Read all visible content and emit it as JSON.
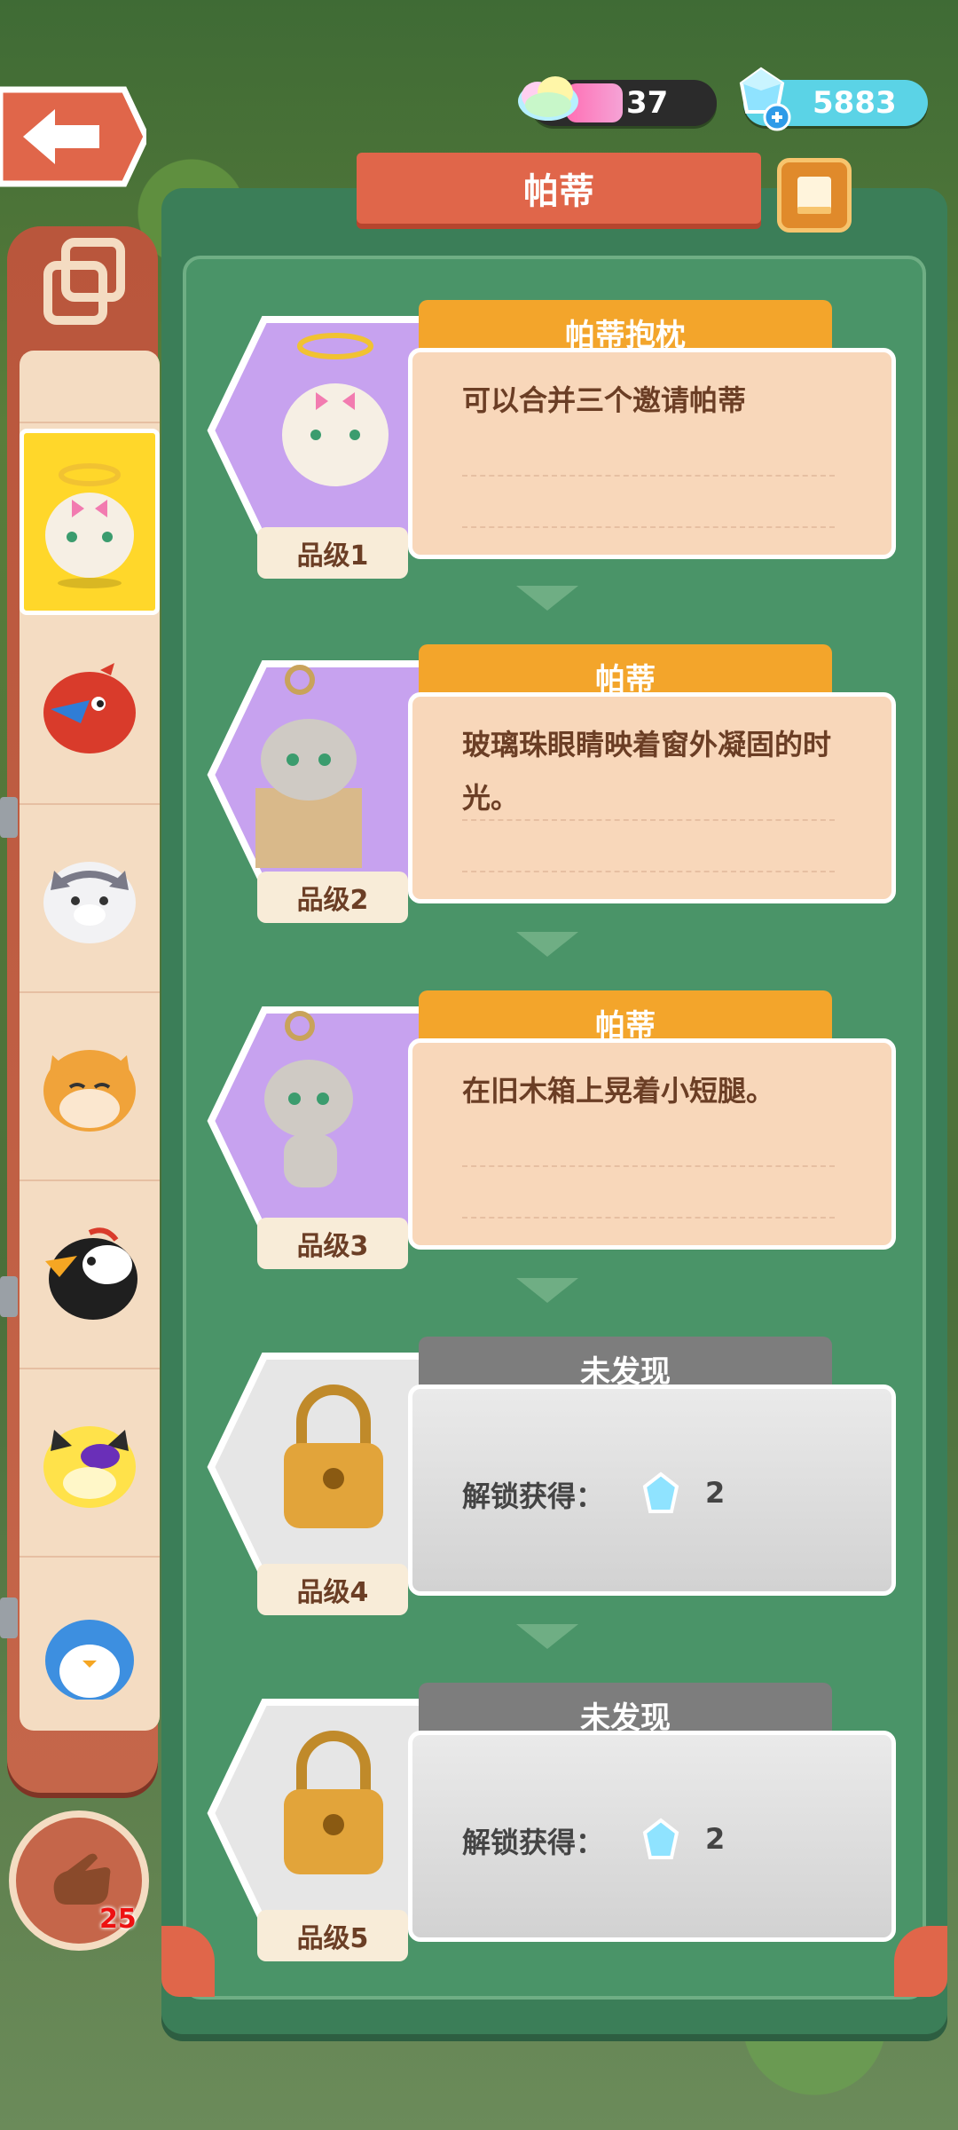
{
  "currency": {
    "rainbow": "37",
    "gems": "5883"
  },
  "title": "帕蒂",
  "sidebar": {
    "hand_count": "25"
  },
  "cards": [
    {
      "label": "帕蒂抱枕",
      "desc": "可以合并三个邀请帕蒂",
      "grade": "品级1",
      "state": "unlocked"
    },
    {
      "label": "帕蒂",
      "desc": "玻璃珠眼睛映着窗外凝固的时光。",
      "grade": "品级2",
      "state": "unlocked"
    },
    {
      "label": "帕蒂",
      "desc": "在旧木箱上晃着小短腿。",
      "grade": "品级3",
      "state": "unlocked"
    },
    {
      "label": "未发现",
      "unlock_text": "解锁获得：",
      "cost": "2",
      "grade": "品级4",
      "state": "locked"
    },
    {
      "label": "未发现",
      "unlock_text": "解锁获得：",
      "cost": "2",
      "grade": "品级5",
      "state": "locked"
    }
  ],
  "colors": {
    "panel": "#3b7e58",
    "ribbon": "#e0664a",
    "label_gold": "#f3a52b",
    "locked_gray": "#7d7d7d"
  }
}
